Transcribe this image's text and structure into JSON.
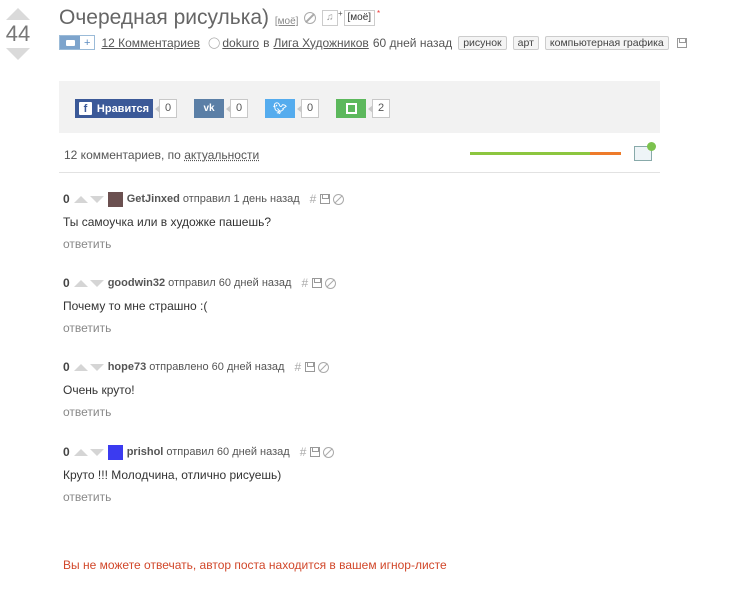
{
  "post": {
    "score": "44",
    "title": "Очередная рисулька)",
    "moe_tag": "[моё]",
    "moe_box": "[моё]",
    "moe_asterisk": "*",
    "photo_plus": "+",
    "comments_link": "12 Комментариев",
    "author": "dokuro",
    "in_word": "в",
    "community": "Лига Художников",
    "time": "60 дней назад",
    "tags": [
      "рисунок",
      "арт",
      "компьютерная графика"
    ]
  },
  "share": {
    "facebook_label": "Нравится",
    "facebook_count": "0",
    "vk_count": "0",
    "twitter_count": "0",
    "save_count": "2"
  },
  "comments_header": {
    "prefix": "12 комментариев, по",
    "sort": "актуальности"
  },
  "comments": [
    {
      "score": "0",
      "user": "GetJinxed",
      "action": "отправил 1 день назад",
      "text": "Ты самоучка или в художке пашешь?",
      "reply": "ответить"
    },
    {
      "score": "0",
      "user": "goodwin32",
      "action": "отправил 60 дней назад",
      "text": "Почему то мне страшно :(",
      "reply": "ответить"
    },
    {
      "score": "0",
      "user": "hope73",
      "action": "отправлено 60 дней назад",
      "text": "Очень круто!",
      "reply": "ответить"
    },
    {
      "score": "0",
      "user": "prishol",
      "action": "отправил 60 дней назад",
      "text": "Круто !!! Молодчина, отлично рисуешь)",
      "reply": "ответить"
    }
  ],
  "ignore_notice": "Вы не можете отвечать, автор поста находится в вашем игнор-листе",
  "colors": {
    "facebook": "#3b5998",
    "vk": "#5b7fa6",
    "twitter": "#55acee",
    "save": "#5cb85c",
    "notice": "#d1472a",
    "bar_green": "#8cc63f",
    "bar_orange": "#ee7b2a"
  }
}
